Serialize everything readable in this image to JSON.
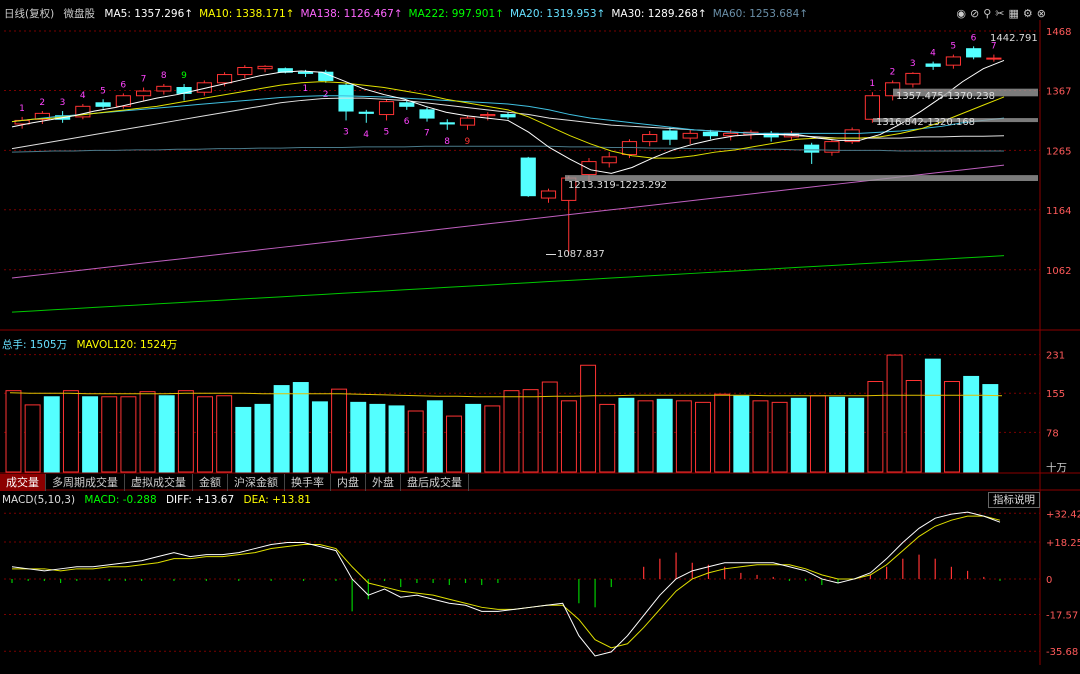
{
  "header": {
    "period_label": "日线(复权)",
    "stock_name": "微盘股",
    "ma": [
      {
        "label": "MA5: 1357.296",
        "color": "#ffffff"
      },
      {
        "label": "MA10: 1338.171",
        "color": "#ffff00"
      },
      {
        "label": "MA138: 1126.467",
        "color": "#ff66ff"
      },
      {
        "label": "MA222: 997.901",
        "color": "#00ff00"
      },
      {
        "label": "MA20: 1319.953",
        "color": "#66e0ff"
      },
      {
        "label": "MA30: 1289.268",
        "color": "#ffffff"
      },
      {
        "label": "MA60: 1253.684",
        "color": "#6a8fa8"
      }
    ],
    "tool_icons": [
      "eye-icon",
      "eye-slash-icon",
      "pin-icon",
      "scissors-icon",
      "grid-icon",
      "settings-icon",
      "close-icon"
    ]
  },
  "volume_header": {
    "label": "总手: 1505万",
    "mavol": "MAVOL120: 1524万"
  },
  "macd_header": {
    "label": "MACD(5,10,3)",
    "macd": "MACD: -0.288",
    "diff": "DIFF: +13.67",
    "dea": "DEA: +13.81"
  },
  "tabs": [
    "成交量",
    "多周期成交量",
    "虚拟成交量",
    "金额",
    "沪深金额",
    "换手率",
    "内盘",
    "外盘",
    "盘后成交量"
  ],
  "active_tab": 0,
  "explain_button": "指标说明",
  "volume_unit": "十万",
  "annotations": {
    "high": "1442.791",
    "low": "1087.837",
    "range1": "1357.475-1370.238",
    "range2": "1316.842-1320.168",
    "range3": "1213.319-1223.292"
  },
  "colors": {
    "up": "#ff3333",
    "down": "#54ffff",
    "grid": "#7a0000"
  },
  "chart_data": [
    {
      "type": "candlestick",
      "yticks": [
        1062,
        1164,
        1265,
        1367,
        1468
      ],
      "ylim": [
        980,
        1480
      ],
      "candles": [
        {
          "o": 1310,
          "h": 1322,
          "l": 1302,
          "c": 1316
        },
        {
          "o": 1318,
          "h": 1332,
          "l": 1310,
          "c": 1328
        },
        {
          "o": 1324,
          "h": 1332,
          "l": 1312,
          "c": 1318
        },
        {
          "o": 1322,
          "h": 1344,
          "l": 1318,
          "c": 1340
        },
        {
          "o": 1346,
          "h": 1352,
          "l": 1336,
          "c": 1340
        },
        {
          "o": 1340,
          "h": 1362,
          "l": 1336,
          "c": 1358
        },
        {
          "o": 1358,
          "h": 1372,
          "l": 1350,
          "c": 1366
        },
        {
          "o": 1366,
          "h": 1378,
          "l": 1360,
          "c": 1374
        },
        {
          "o": 1372,
          "h": 1378,
          "l": 1350,
          "c": 1362
        },
        {
          "o": 1364,
          "h": 1384,
          "l": 1358,
          "c": 1380
        },
        {
          "o": 1380,
          "h": 1398,
          "l": 1374,
          "c": 1394
        },
        {
          "o": 1394,
          "h": 1410,
          "l": 1388,
          "c": 1406
        },
        {
          "o": 1404,
          "h": 1410,
          "l": 1398,
          "c": 1408
        },
        {
          "o": 1404,
          "h": 1406,
          "l": 1396,
          "c": 1398
        },
        {
          "o": 1398,
          "h": 1402,
          "l": 1390,
          "c": 1396
        },
        {
          "o": 1398,
          "h": 1402,
          "l": 1380,
          "c": 1384
        },
        {
          "o": 1376,
          "h": 1380,
          "l": 1316,
          "c": 1332
        },
        {
          "o": 1330,
          "h": 1334,
          "l": 1312,
          "c": 1328
        },
        {
          "o": 1326,
          "h": 1352,
          "l": 1316,
          "c": 1348
        },
        {
          "o": 1346,
          "h": 1350,
          "l": 1334,
          "c": 1340
        },
        {
          "o": 1334,
          "h": 1338,
          "l": 1314,
          "c": 1320
        },
        {
          "o": 1312,
          "h": 1318,
          "l": 1300,
          "c": 1310
        },
        {
          "o": 1308,
          "h": 1324,
          "l": 1300,
          "c": 1320
        },
        {
          "o": 1324,
          "h": 1330,
          "l": 1316,
          "c": 1326
        },
        {
          "o": 1326,
          "h": 1330,
          "l": 1318,
          "c": 1322
        },
        {
          "o": 1252,
          "h": 1254,
          "l": 1186,
          "c": 1188
        },
        {
          "o": 1184,
          "h": 1200,
          "l": 1176,
          "c": 1196
        },
        {
          "o": 1180,
          "h": 1222,
          "l": 1088,
          "c": 1218
        },
        {
          "o": 1224,
          "h": 1252,
          "l": 1212,
          "c": 1246
        },
        {
          "o": 1244,
          "h": 1262,
          "l": 1236,
          "c": 1254
        },
        {
          "o": 1258,
          "h": 1284,
          "l": 1252,
          "c": 1280
        },
        {
          "o": 1280,
          "h": 1298,
          "l": 1272,
          "c": 1292
        },
        {
          "o": 1298,
          "h": 1304,
          "l": 1274,
          "c": 1284
        },
        {
          "o": 1286,
          "h": 1300,
          "l": 1276,
          "c": 1294
        },
        {
          "o": 1296,
          "h": 1300,
          "l": 1284,
          "c": 1290
        },
        {
          "o": 1290,
          "h": 1300,
          "l": 1282,
          "c": 1294
        },
        {
          "o": 1292,
          "h": 1300,
          "l": 1284,
          "c": 1296
        },
        {
          "o": 1294,
          "h": 1298,
          "l": 1280,
          "c": 1288
        },
        {
          "o": 1288,
          "h": 1298,
          "l": 1282,
          "c": 1294
        },
        {
          "o": 1274,
          "h": 1278,
          "l": 1242,
          "c": 1262
        },
        {
          "o": 1262,
          "h": 1284,
          "l": 1256,
          "c": 1280
        },
        {
          "o": 1280,
          "h": 1304,
          "l": 1276,
          "c": 1300
        },
        {
          "o": 1318,
          "h": 1364,
          "l": 1312,
          "c": 1358
        },
        {
          "o": 1358,
          "h": 1384,
          "l": 1350,
          "c": 1380
        },
        {
          "o": 1378,
          "h": 1398,
          "l": 1372,
          "c": 1396
        },
        {
          "o": 1412,
          "h": 1416,
          "l": 1402,
          "c": 1408
        },
        {
          "o": 1410,
          "h": 1428,
          "l": 1404,
          "c": 1424
        },
        {
          "o": 1438,
          "h": 1442,
          "l": 1420,
          "c": 1424
        },
        {
          "o": 1422,
          "h": 1428,
          "l": 1416,
          "c": 1422
        }
      ],
      "ma5": [
        1305,
        1312,
        1318,
        1324,
        1332,
        1338,
        1346,
        1354,
        1360,
        1368,
        1376,
        1384,
        1392,
        1398,
        1400,
        1398,
        1384,
        1370,
        1360,
        1352,
        1340,
        1330,
        1324,
        1320,
        1316,
        1296,
        1270,
        1250,
        1232,
        1226,
        1236,
        1252,
        1266,
        1276,
        1284,
        1290,
        1292,
        1292,
        1292,
        1286,
        1282,
        1282,
        1292,
        1310,
        1332,
        1356,
        1382,
        1404,
        1418
      ],
      "ma10": [
        1314,
        1318,
        1320,
        1324,
        1328,
        1332,
        1336,
        1340,
        1346,
        1352,
        1358,
        1364,
        1370,
        1376,
        1380,
        1382,
        1380,
        1376,
        1372,
        1366,
        1360,
        1352,
        1346,
        1340,
        1334,
        1322,
        1306,
        1290,
        1276,
        1264,
        1256,
        1252,
        1252,
        1256,
        1262,
        1266,
        1272,
        1278,
        1284,
        1286,
        1286,
        1286,
        1288,
        1294,
        1302,
        1314,
        1328,
        1342,
        1356
      ],
      "ma20": [
        1314,
        1318,
        1322,
        1325,
        1328,
        1331,
        1334,
        1337,
        1340,
        1343,
        1346,
        1349,
        1352,
        1355,
        1357,
        1358,
        1358,
        1357,
        1356,
        1354,
        1352,
        1350,
        1348,
        1346,
        1344,
        1340,
        1334,
        1326,
        1320,
        1316,
        1312,
        1308,
        1304,
        1300,
        1298,
        1296,
        1294,
        1294,
        1294,
        1294,
        1294,
        1294,
        1296,
        1298,
        1302,
        1306,
        1312,
        1316,
        1320
      ],
      "ma30": [
        1268,
        1274,
        1280,
        1286,
        1292,
        1298,
        1304,
        1310,
        1316,
        1322,
        1328,
        1334,
        1340,
        1346,
        1350,
        1353,
        1354,
        1354,
        1352,
        1350,
        1346,
        1342,
        1338,
        1334,
        1330,
        1326,
        1320,
        1316,
        1312,
        1308,
        1306,
        1304,
        1302,
        1300,
        1298,
        1296,
        1294,
        1292,
        1290,
        1288,
        1286,
        1286,
        1286,
        1286,
        1288,
        1288,
        1289,
        1289,
        1290
      ],
      "ma60": [
        1262,
        1263,
        1264,
        1264,
        1265,
        1265,
        1266,
        1266,
        1267,
        1267,
        1268,
        1268,
        1269,
        1269,
        1270,
        1270,
        1270,
        1271,
        1271,
        1271,
        1272,
        1272,
        1272,
        1272,
        1272,
        1272,
        1272,
        1271,
        1271,
        1270,
        1270,
        1269,
        1269,
        1268,
        1268,
        1268,
        1267,
        1267,
        1266,
        1266,
        1265,
        1265,
        1265,
        1264,
        1264,
        1264,
        1264,
        1264,
        1264
      ],
      "ma138": [
        1048,
        1052,
        1056,
        1060,
        1064,
        1068,
        1072,
        1076,
        1080,
        1084,
        1088,
        1092,
        1096,
        1100,
        1104,
        1108,
        1112,
        1116,
        1120,
        1124,
        1128,
        1132,
        1136,
        1140,
        1144,
        1148,
        1152,
        1156,
        1160,
        1164,
        1168,
        1172,
        1176,
        1180,
        1184,
        1188,
        1192,
        1196,
        1200,
        1204,
        1208,
        1212,
        1216,
        1220,
        1224,
        1228,
        1232,
        1236,
        1240
      ],
      "ma222": [
        990,
        992,
        994,
        996,
        998,
        1000,
        1002,
        1004,
        1006,
        1008,
        1010,
        1012,
        1014,
        1016,
        1018,
        1020,
        1022,
        1024,
        1026,
        1028,
        1030,
        1032,
        1034,
        1036,
        1038,
        1040,
        1042,
        1044,
        1046,
        1048,
        1050,
        1052,
        1054,
        1056,
        1058,
        1060,
        1062,
        1064,
        1066,
        1068,
        1070,
        1072,
        1074,
        1076,
        1078,
        1080,
        1082,
        1084,
        1086
      ],
      "seq_labels": [
        "1",
        "2",
        "3",
        "4",
        "5",
        "6",
        "7",
        "8",
        "9",
        "",
        "",
        "",
        "",
        "",
        "1",
        "2",
        "3",
        "4",
        "5",
        "6",
        "7",
        "8",
        "9",
        "",
        "",
        "",
        "",
        "",
        "",
        "",
        "",
        "",
        "",
        "",
        "",
        "",
        "",
        "",
        "",
        "",
        "",
        "",
        "1",
        "2",
        "3",
        "4",
        "5",
        "6",
        "7"
      ]
    },
    {
      "type": "bar",
      "yticks": [
        78,
        155,
        231
      ],
      "ylim": [
        0,
        240
      ],
      "values": [
        160,
        132,
        148,
        160,
        148,
        148,
        148,
        158,
        150,
        160,
        148,
        150,
        127,
        133,
        170,
        176,
        138,
        163,
        137,
        133,
        130,
        120,
        140,
        110,
        133,
        130,
        160,
        162,
        177,
        140,
        210,
        133,
        145,
        140,
        143,
        140,
        137,
        153,
        150,
        140,
        137,
        145,
        150,
        147,
        145,
        178,
        230,
        180,
        222,
        178,
        188,
        172
      ],
      "up": [
        true,
        true,
        false,
        true,
        false,
        true,
        true,
        true,
        false,
        true,
        true,
        true,
        false,
        false,
        false,
        false,
        false,
        true,
        false,
        false,
        false,
        true,
        false,
        true,
        false,
        true,
        true,
        true,
        true,
        true,
        true,
        true,
        false,
        true,
        false,
        true,
        true,
        true,
        false,
        true,
        true,
        false,
        true,
        false,
        false,
        true,
        true,
        true,
        false,
        true,
        false,
        false
      ],
      "mavol": [
        156,
        155,
        155,
        155,
        154,
        154,
        154,
        154,
        154,
        155,
        155,
        155,
        155,
        154,
        154,
        154,
        154,
        154,
        153,
        152,
        151,
        150,
        149,
        149,
        148,
        148,
        148,
        148,
        149,
        149,
        150,
        150,
        151,
        151,
        151,
        151,
        151,
        151,
        151,
        150,
        150,
        150,
        150,
        150,
        150,
        151,
        151,
        151,
        151,
        151,
        151,
        150
      ]
    },
    {
      "type": "line",
      "yticks": [
        32.42,
        18.25,
        0,
        -17.57,
        -35.68
      ],
      "ylim": [
        -40,
        36
      ],
      "diff": [
        6,
        5,
        4,
        5,
        6,
        6,
        7,
        8,
        9,
        11,
        13,
        11,
        12,
        12,
        13,
        15,
        17,
        18,
        18,
        16,
        14,
        0,
        -8,
        -5,
        -9,
        -8,
        -10,
        -12,
        -13,
        -16,
        -16,
        -15,
        -14,
        -13,
        -12,
        -28,
        -38,
        -36,
        -28,
        -18,
        -8,
        0,
        4,
        6,
        8,
        8,
        8,
        8,
        6,
        4,
        0,
        -2,
        0,
        3,
        10,
        18,
        25,
        30,
        32,
        33,
        31,
        28
      ],
      "dea": [
        5,
        5,
        5,
        4,
        5,
        5,
        6,
        6,
        7,
        8,
        10,
        10,
        11,
        11,
        12,
        13,
        15,
        16,
        17,
        17,
        15,
        6,
        -2,
        -4,
        -6,
        -7,
        -8,
        -10,
        -12,
        -14,
        -15,
        -15,
        -14,
        -13,
        -13,
        -20,
        -30,
        -34,
        -32,
        -24,
        -15,
        -6,
        0,
        3,
        5,
        6,
        7,
        7,
        7,
        5,
        2,
        0,
        0,
        2,
        7,
        14,
        21,
        26,
        29,
        31,
        31,
        29
      ],
      "hist": [
        -2,
        -1,
        -1,
        -2,
        -1,
        0,
        -1,
        -1,
        -1,
        0,
        -1,
        0,
        -1,
        0,
        -1,
        0,
        -1,
        0,
        -1,
        0,
        -1,
        -16,
        -10,
        -1,
        -4,
        -2,
        -2,
        -3,
        -2,
        -3,
        -2,
        0,
        0,
        0,
        0,
        -12,
        -14,
        -4,
        0,
        6,
        10,
        13,
        8,
        7,
        6,
        3,
        2,
        1,
        -1,
        -1,
        -3,
        -2,
        0,
        2,
        6,
        10,
        12,
        10,
        6,
        4,
        1,
        -1
      ]
    }
  ]
}
